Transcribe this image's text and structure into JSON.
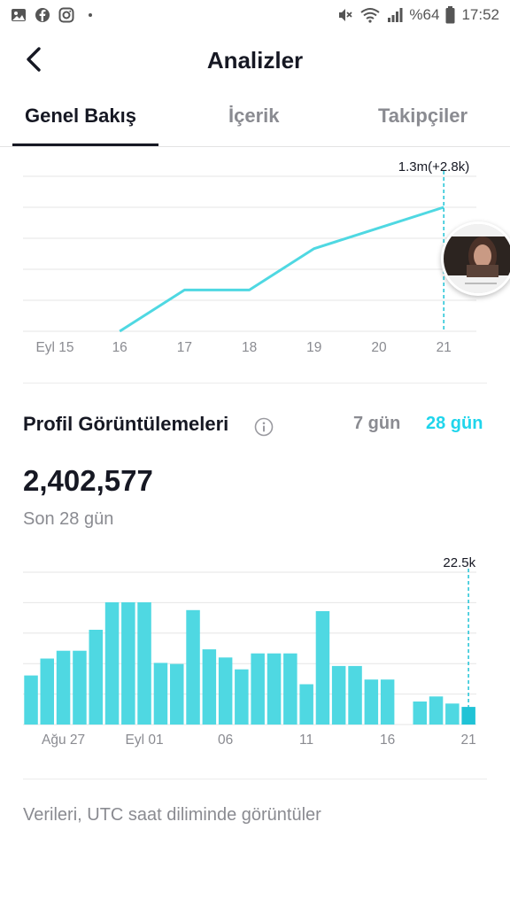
{
  "status_bar": {
    "battery": "%64",
    "time": "17:52",
    "left_icons": [
      "gallery-icon",
      "facebook-icon",
      "instagram-icon",
      "dot-icon"
    ],
    "right_icons": [
      "mute-icon",
      "wifi-icon",
      "signal-icon",
      "battery-icon"
    ]
  },
  "header": {
    "title": "Analizler"
  },
  "tabs": [
    {
      "label": "Genel Bakış",
      "active": true
    },
    {
      "label": "İçerik",
      "active": false
    },
    {
      "label": "Takipçiler",
      "active": false
    }
  ],
  "video_views_chart": {
    "chart_data": {
      "type": "line",
      "categories": [
        "Eyl 15",
        "16",
        "17",
        "18",
        "19",
        "20",
        "21"
      ],
      "values": [
        null,
        0,
        1,
        1,
        2,
        2.5,
        3
      ],
      "highlight_label": "1.3m(+2.8k)",
      "highlight_index": 6,
      "gridlines": 6,
      "color": "#4fd8e2"
    }
  },
  "profile_views": {
    "title": "Profil Görüntülemeleri",
    "range_7": "7 gün",
    "range_28": "28 gün",
    "selected_range": "28 gün",
    "total": "2,402,577",
    "period": "Son 28 gün",
    "chart_data": {
      "type": "bar",
      "tick_labels": [
        "Ağu 27",
        "Eyl 01",
        "06",
        "11",
        "16",
        "21"
      ],
      "tick_positions": [
        2,
        7,
        12,
        17,
        22,
        27
      ],
      "values": [
        14.5,
        19.5,
        21.8,
        21.8,
        28.0,
        36.1,
        36.1,
        36.1,
        18.2,
        17.9,
        33.8,
        22.2,
        19.8,
        16.3,
        21.0,
        21.0,
        21.0,
        11.9,
        33.5,
        17.3,
        17.3,
        13.3,
        13.3,
        null,
        6.8,
        8.3,
        6.2,
        5.2
      ],
      "highlight_label": "22.5k",
      "highlight_index": 27,
      "ylim": [
        0,
        45
      ],
      "gridlines": 6,
      "color": "#4fd8e2",
      "highlight_color": "#20c3d6"
    }
  },
  "footnote": "Verileri, UTC saat diliminde görüntüler"
}
